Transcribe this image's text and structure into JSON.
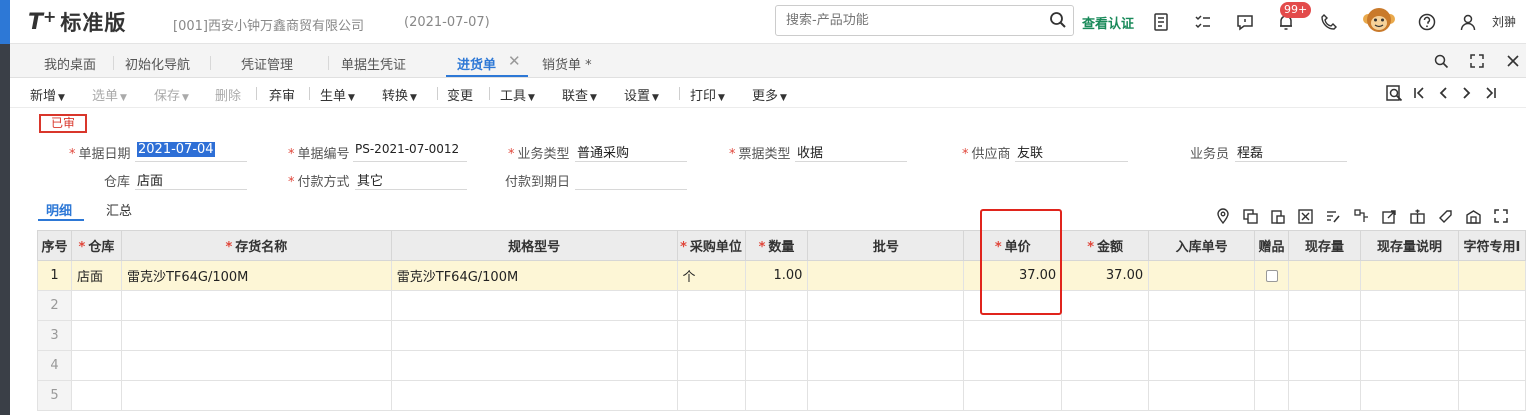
{
  "header": {
    "logo_t": "T",
    "logo_plus": "+",
    "logo_text": "标准版",
    "company": "[001]西安小钟万鑫商贸有限公司",
    "date": "(2021-07-07)",
    "search_placeholder": "搜索-产品功能",
    "verify_label": "查看认证",
    "notification_badge": "99+",
    "username": "刘翀"
  },
  "tabs": [
    {
      "label": "我的桌面"
    },
    {
      "label": "初始化导航"
    },
    {
      "label": "凭证管理"
    },
    {
      "label": "单据生凭证"
    },
    {
      "label": "进货单"
    },
    {
      "label": "销货单 *"
    }
  ],
  "toolbar": [
    {
      "label": "新增"
    },
    {
      "label": "选单"
    },
    {
      "label": "保存"
    },
    {
      "label": "删除"
    },
    {
      "label": "弃审"
    },
    {
      "label": "生单"
    },
    {
      "label": "转换"
    },
    {
      "label": "变更"
    },
    {
      "label": "工具"
    },
    {
      "label": "联查"
    },
    {
      "label": "设置"
    },
    {
      "label": "打印"
    },
    {
      "label": "更多"
    }
  ],
  "status_stamp": "已审",
  "form": {
    "date_label": "单据日期",
    "date_value": "2021-07-04",
    "number_label": "单据编号",
    "number_value": "PS-2021-07-0012",
    "biztype_label": "业务类型",
    "biztype_value": "普通采购",
    "invoice_label": "票据类型",
    "invoice_value": "收据",
    "supplier_label": "供应商",
    "supplier_value": "友联",
    "clerk_label": "业务员",
    "clerk_value": "程磊",
    "warehouse_label": "仓库",
    "warehouse_value": "店面",
    "payment_label": "付款方式",
    "payment_value": "其它",
    "duedate_label": "付款到期日",
    "duedate_value": ""
  },
  "subtabs": [
    {
      "label": "明细"
    },
    {
      "label": "汇总"
    }
  ],
  "table": {
    "headers": [
      "序号",
      "仓库",
      "存货名称",
      "规格型号",
      "采购单位",
      "数量",
      "批号",
      "单价",
      "金额",
      "入库单号",
      "赠品",
      "现存量",
      "现存量说明",
      "字符专用Ⅰ"
    ],
    "rows": [
      {
        "idx": "1",
        "warehouse": "店面",
        "name": "雷克沙TF64G/100M",
        "spec": "雷克沙TF64G/100M",
        "unit": "个",
        "qty": "1.00",
        "batch": "",
        "price": "37.00",
        "amount": "37.00",
        "receipt": ""
      },
      {
        "idx": "2"
      },
      {
        "idx": "3"
      },
      {
        "idx": "4"
      },
      {
        "idx": "5"
      }
    ]
  }
}
